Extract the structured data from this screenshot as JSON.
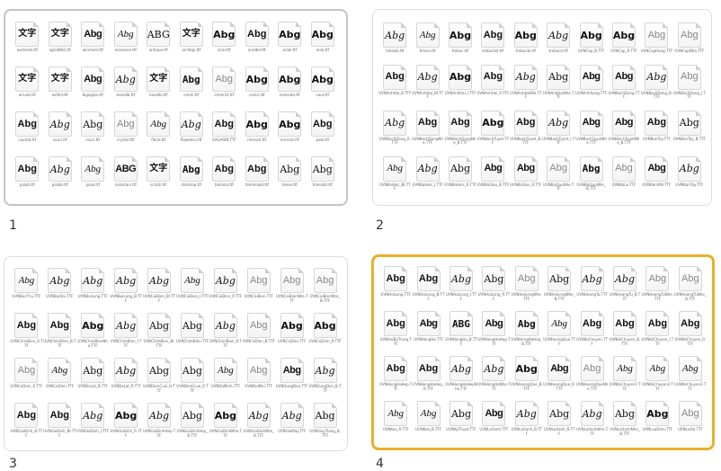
{
  "thumbnails": [
    {
      "caption": "1",
      "rows": [
        [
          {
            "glyph": "文字",
            "style": "cjk",
            "name": "aachenb.ttf"
          },
          {
            "glyph": "文字",
            "style": "cjk",
            "name": "agrotBlkt.ttf"
          },
          {
            "glyph": "Abg",
            "style": "black",
            "name": "aknimim.ttf"
          },
          {
            "glyph": "Abg",
            "style": "script",
            "name": "amazone.ttf"
          },
          {
            "glyph": "ABG",
            "style": "serif",
            "name": "antique.ttf"
          },
          {
            "glyph": "文字",
            "style": "cjk",
            "name": "archbpi.ttf"
          },
          {
            "glyph": "Abg",
            "style": "sans",
            "name": "arial.ttf"
          },
          {
            "glyph": "Abg",
            "style": "bold",
            "name": "arialbd.ttf"
          },
          {
            "glyph": "Abg",
            "style": "sans",
            "name": "ariali.ttf"
          },
          {
            "glyph": "Abg",
            "style": "sans",
            "name": "arial.ttf"
          }
        ],
        [
          {
            "glyph": "文字",
            "style": "cjk",
            "name": "arrude.ttf"
          },
          {
            "glyph": "文字",
            "style": "cjk",
            "name": "asfeld.ttf"
          },
          {
            "glyph": "Abg",
            "style": "black",
            "name": "bigapple.ttf"
          },
          {
            "glyph": "Abg",
            "style": "italic",
            "name": "bissallb.ttf"
          },
          {
            "glyph": "文字",
            "style": "cjk",
            "name": "bivaldo.ttf"
          },
          {
            "glyph": "Abg",
            "style": "mono",
            "name": "cmmi.ttf"
          },
          {
            "glyph": "Abg",
            "style": "light",
            "name": "cmmi10.ttf"
          },
          {
            "glyph": "Abg",
            "style": "sans",
            "name": "comic.ttf"
          },
          {
            "glyph": "Abg",
            "style": "sans",
            "name": "comicbd.ttf"
          },
          {
            "glyph": "Abg",
            "style": "sans",
            "name": "cour.ttf"
          }
        ],
        [
          {
            "glyph": "Abg",
            "style": "bold",
            "name": "courbd.ttf"
          },
          {
            "glyph": "Abg",
            "style": "italic",
            "name": "couri.ttf"
          },
          {
            "glyph": "Abg",
            "style": "serif",
            "name": "couri.ttf"
          },
          {
            "glyph": "Abg",
            "style": "light",
            "name": "crystal.ttf"
          },
          {
            "glyph": "Abg",
            "style": "script",
            "name": "floral.ttf"
          },
          {
            "glyph": "Abg",
            "style": "italic",
            "name": "flowdeco.ttf"
          },
          {
            "glyph": "Abg",
            "style": "bold",
            "name": "GAGARIN.TTF"
          },
          {
            "glyph": "Abg",
            "style": "sans",
            "name": "meroch.ttf"
          },
          {
            "glyph": "Abg",
            "style": "sans",
            "name": "micross.ttf"
          },
          {
            "glyph": "Abg",
            "style": "bold",
            "name": "pala.ttf"
          }
        ],
        [
          {
            "glyph": "Abg",
            "style": "bold",
            "name": "palab.ttf"
          },
          {
            "glyph": "Abg",
            "style": "italic",
            "name": "palabi.ttf"
          },
          {
            "glyph": "Abg",
            "style": "script",
            "name": "palai.ttf"
          },
          {
            "glyph": "ABG",
            "style": "black",
            "name": "rockstars.ttf"
          },
          {
            "glyph": "文字",
            "style": "cjk",
            "name": "scripti.ttf"
          },
          {
            "glyph": "Abg",
            "style": "mono",
            "name": "stardrop.ttf"
          },
          {
            "glyph": "Abg",
            "style": "bold",
            "name": "tahoma.ttf"
          },
          {
            "glyph": "Abg",
            "style": "bold",
            "name": "tahomabd.ttf"
          },
          {
            "glyph": "Abg",
            "style": "serif",
            "name": "times.ttf"
          },
          {
            "glyph": "Abg",
            "style": "serif",
            "name": "timesbd.ttf"
          }
        ]
      ]
    },
    {
      "caption": "2",
      "rows": [
        [
          {
            "glyph": "Abg",
            "style": "italic",
            "name": "timesbi.ttf"
          },
          {
            "glyph": "Abg",
            "style": "script",
            "name": "timesi.ttf"
          },
          {
            "glyph": "Abg",
            "style": "sans",
            "name": "trebuc.ttf"
          },
          {
            "glyph": "Abg",
            "style": "bold",
            "name": "trebucbd.ttf"
          },
          {
            "glyph": "Abg",
            "style": "sans",
            "name": "trebucbi.ttf"
          },
          {
            "glyph": "Abg",
            "style": "italic",
            "name": "trebucit.ttf"
          },
          {
            "glyph": "Abg",
            "style": "sans",
            "name": "UVNCap_B.TTF"
          },
          {
            "glyph": "Abg",
            "style": "sans",
            "name": "UVNCap_R.TTF"
          },
          {
            "glyph": "Abg",
            "style": "light",
            "name": "UVNCapHang.TTF"
          },
          {
            "glyph": "Abg",
            "style": "light",
            "name": "UVNCapNha.TTF"
          }
        ],
        [
          {
            "glyph": "Abg",
            "style": "bold",
            "name": "UVNAnhHai_B.TTF"
          },
          {
            "glyph": "Abg",
            "style": "italic",
            "name": "UVNAnhHai_BI.TTF"
          },
          {
            "glyph": "Abg",
            "style": "sans",
            "name": "UVNAnhHai_I.TTF"
          },
          {
            "glyph": "Abg",
            "style": "bold",
            "name": "UVNAnhHai_R.TTF"
          },
          {
            "glyph": "Abg",
            "style": "italic",
            "name": "UVNAnhHaiBlk.TTF"
          },
          {
            "glyph": "Abg",
            "style": "serif",
            "name": "UVNAnhHaiNhe.TTF"
          },
          {
            "glyph": "Abg",
            "style": "black",
            "name": "UVNAnhSang.TTF"
          },
          {
            "glyph": "Abg",
            "style": "black",
            "name": "UVNBachDang.TTF"
          },
          {
            "glyph": "Abg",
            "style": "italic",
            "name": "UVNBachDang_B.TTF"
          },
          {
            "glyph": "Abg",
            "style": "light",
            "name": "UVNBachDang_I.TTF"
          }
        ],
        [
          {
            "glyph": "Abg",
            "style": "italic",
            "name": "UVNBachDang_R.TTF"
          },
          {
            "glyph": "Abg",
            "style": "bold",
            "name": "UVNBachDangNhe.TTF"
          },
          {
            "glyph": "Abg",
            "style": "bold",
            "name": "UVNBachDangNhe_B.TTF"
          },
          {
            "glyph": "Abg",
            "style": "sans",
            "name": "UVNBachTuyet.TTF"
          },
          {
            "glyph": "Abg",
            "style": "bold",
            "name": "UVNBachTuyet_B.TTF"
          },
          {
            "glyph": "Abg",
            "style": "italic",
            "name": "UVNBachTuyet_I.TTF"
          },
          {
            "glyph": "Abg",
            "style": "black",
            "name": "UVNBachTuyetNhe.TTF"
          },
          {
            "glyph": "Abg",
            "style": "black",
            "name": "UVNBachTuyetNhe_B.TTF"
          },
          {
            "glyph": "Abg",
            "style": "bold",
            "name": "UVNBanTay.TTF"
          },
          {
            "glyph": "Abg",
            "style": "serif",
            "name": "UVNBanTay_B.TTF"
          }
        ],
        [
          {
            "glyph": "Abg",
            "style": "script",
            "name": "UVNBaiHoc_BI.TTF"
          },
          {
            "glyph": "Abg",
            "style": "italic",
            "name": "UVNBaiHoc_I.TTF"
          },
          {
            "glyph": "Abg",
            "style": "serif",
            "name": "UVNBaiHoc_R.TTF"
          },
          {
            "glyph": "Abg",
            "style": "black",
            "name": "UVNBaiSau_B.TTF"
          },
          {
            "glyph": "Abg",
            "style": "black",
            "name": "UVNBaiSau_R.TTF"
          },
          {
            "glyph": "Abg",
            "style": "light",
            "name": "UVNBaiSauNhe.TTF"
          },
          {
            "glyph": "Abg",
            "style": "mono",
            "name": "UVNBaiSauNhe_B.TTF"
          },
          {
            "glyph": "Abg",
            "style": "light",
            "name": "UVNBaLe.TTF"
          },
          {
            "glyph": "Abg",
            "style": "black",
            "name": "UVNBanhMi.TTF"
          },
          {
            "glyph": "Abg",
            "style": "italic",
            "name": "UVNBanTay.TTF"
          }
        ]
      ]
    },
    {
      "caption": "3",
      "rows": [
        [
          {
            "glyph": "Abg",
            "style": "script",
            "name": "UVNBucThu.TTF"
          },
          {
            "glyph": "Abg",
            "style": "italic",
            "name": "UVNBuiDoi.TTF"
          },
          {
            "glyph": "Abg",
            "style": "italic",
            "name": "UVNBuiLong.TTF"
          },
          {
            "glyph": "Abg",
            "style": "italic",
            "name": "UVNBuiLong_B.TTF"
          },
          {
            "glyph": "Abg",
            "style": "italic",
            "name": "UVNCaiBien_BI.TTF"
          },
          {
            "glyph": "Abg",
            "style": "script",
            "name": "UVNCaiBien_I.TTF"
          },
          {
            "glyph": "Abg",
            "style": "italic",
            "name": "UVNCaiBien_R.TTF"
          },
          {
            "glyph": "Abg",
            "style": "light",
            "name": "UVNCaiBien.TTF"
          },
          {
            "glyph": "Abg",
            "style": "light",
            "name": "UVNCaiBienNhe.TTF"
          },
          {
            "glyph": "Abg",
            "style": "light",
            "name": "UVNCaiBienNhe_B.TTF"
          }
        ],
        [
          {
            "glyph": "Abg",
            "style": "bold",
            "name": "UVNChimBien_R.TTF"
          },
          {
            "glyph": "Abg",
            "style": "bold",
            "name": "UVNChimBien_B.TTF"
          },
          {
            "glyph": "Abg",
            "style": "sans",
            "name": "UVNChimBienNhe.TTF"
          },
          {
            "glyph": "Abg",
            "style": "italic",
            "name": "UVNChimBien_I.TTF"
          },
          {
            "glyph": "Abg",
            "style": "serif",
            "name": "UVNChimBien_BI.TTF"
          },
          {
            "glyph": "Abg",
            "style": "serif",
            "name": "UVNChimBien.TTF"
          },
          {
            "glyph": "Abg",
            "style": "italic",
            "name": "UVNChimBien_R.TTF"
          },
          {
            "glyph": "Abg",
            "style": "light",
            "name": "UVNCoDien_B.TTF"
          },
          {
            "glyph": "Abg",
            "style": "sans",
            "name": "UVNCoDien.TTF"
          },
          {
            "glyph": "Abg",
            "style": "sans",
            "name": "UVNCoDien_R.TTF"
          }
        ],
        [
          {
            "glyph": "Abg",
            "style": "light",
            "name": "UVNCoDien_R.TTF"
          },
          {
            "glyph": "Abg",
            "style": "script",
            "name": "UVNCoDien.TTF"
          },
          {
            "glyph": "Abg",
            "style": "serif",
            "name": "UVNDaLat_B.TTF"
          },
          {
            "glyph": "Abg",
            "style": "italic",
            "name": "UVNDaLat_R.TTF"
          },
          {
            "glyph": "Abg",
            "style": "serif",
            "name": "UVNDamCuoi_H.TTF"
          },
          {
            "glyph": "Abg",
            "style": "serif",
            "name": "UVNDamCuoi_R.TTF"
          },
          {
            "glyph": "Abg",
            "style": "script",
            "name": "UVNDaMinh.TTF"
          },
          {
            "glyph": "Abg",
            "style": "light",
            "name": "UVNDoiMoi.TTF"
          },
          {
            "glyph": "Abg",
            "style": "black",
            "name": "UVNDungDan.TTF"
          },
          {
            "glyph": "Abg",
            "style": "italic",
            "name": "UVNDungDan_B.TTF"
          }
        ],
        [
          {
            "glyph": "Abg",
            "style": "bold",
            "name": "UVNGiaDinh_B.TTF"
          },
          {
            "glyph": "Abg",
            "style": "bold",
            "name": "UVNGiaDinh_BI.TTF"
          },
          {
            "glyph": "Abg",
            "style": "italic",
            "name": "UVNGiaDinh_I.TTF"
          },
          {
            "glyph": "Abg",
            "style": "sans",
            "name": "UVNGiaDinh_R.TTF"
          },
          {
            "glyph": "Abg",
            "style": "italic",
            "name": "UVNGiaDinhHep.TTF"
          },
          {
            "glyph": "Abg",
            "style": "serif",
            "name": "UVNGiaDinhHep_B.TTF"
          },
          {
            "glyph": "Abg",
            "style": "sans",
            "name": "UVNGiaDinhNhe.TTF"
          },
          {
            "glyph": "Abg",
            "style": "italic",
            "name": "UVNGiaDinhNhe_B.TTF"
          },
          {
            "glyph": "Abg",
            "style": "italic",
            "name": "UVNGioMay.TTF"
          },
          {
            "glyph": "Abg",
            "style": "serif",
            "name": "UVNGiayTrang_B.TTF"
          }
        ]
      ]
    },
    {
      "caption": "4",
      "rows": [
        [
          {
            "glyph": "Abg",
            "style": "bold",
            "name": "UVNHaiLong.TTF"
          },
          {
            "glyph": "Abg",
            "style": "bold",
            "name": "UVNHaiLong_B.TTF"
          },
          {
            "glyph": "Abg",
            "style": "italic",
            "name": "UVNHaiLong_I.TTF"
          },
          {
            "glyph": "Abg",
            "style": "serif",
            "name": "UVNHaiLong_R.TTF"
          },
          {
            "glyph": "Abg",
            "style": "light",
            "name": "UVNHaiLongNhe.TTF"
          },
          {
            "glyph": "Abg",
            "style": "serif",
            "name": "UVNHaiLongNhe_B.TTF"
          },
          {
            "glyph": "Abg",
            "style": "italic",
            "name": "UVNHoangTu.TTF"
          },
          {
            "glyph": "Abg",
            "style": "italic",
            "name": "UVNHoangTu_B.TTF"
          },
          {
            "glyph": "Abg",
            "style": "light",
            "name": "UVNHoangTuNhe.TTF"
          },
          {
            "glyph": "Abg",
            "style": "light",
            "name": "UVNHoangTuNhe_B.TTF"
          }
        ],
        [
          {
            "glyph": "Abg",
            "style": "bold",
            "name": "UVNHaiBaTrung.TTF"
          },
          {
            "glyph": "Abg",
            "style": "black",
            "name": "UVNHongHa.TTF"
          },
          {
            "glyph": "ABG",
            "style": "mono",
            "name": "UVNHongHa_B.TTF"
          },
          {
            "glyph": "Abg",
            "style": "black",
            "name": "UVNHongHaHep.TTF"
          },
          {
            "glyph": "Abg",
            "style": "mono",
            "name": "UVNHongHaHep_B.TTF"
          },
          {
            "glyph": "Abg",
            "style": "script",
            "name": "UVNHuongQue.TTF"
          },
          {
            "glyph": "Abg",
            "style": "bold",
            "name": "UVNKeChuyen.TTF"
          },
          {
            "glyph": "Abg",
            "style": "bold",
            "name": "UVNKeChuyen_B.TTF"
          },
          {
            "glyph": "Abg",
            "style": "bold",
            "name": "UVNKeChuyen_I.TTF"
          },
          {
            "glyph": "Abg",
            "style": "bold",
            "name": "UVNKeChuyen_R.TTF"
          }
        ],
        [
          {
            "glyph": "Abg",
            "style": "bold",
            "name": "UVNHongHaHep.TTF"
          },
          {
            "glyph": "Abg",
            "style": "bold",
            "name": "UVNHongHaHep_R.TTF"
          },
          {
            "glyph": "Abg",
            "style": "italic",
            "name": "UVNHongHaHepNhe.TTF"
          },
          {
            "glyph": "Abg",
            "style": "italic",
            "name": "UVNHongHaNhe.TTF"
          },
          {
            "glyph": "Abg",
            "style": "sans",
            "name": "UVNHuongQue_B.TTF"
          },
          {
            "glyph": "Abg",
            "style": "black",
            "name": "UVNHuongQue_R.TTF"
          },
          {
            "glyph": "Abg",
            "style": "light",
            "name": "UVNHuongQueNhe.TTF"
          },
          {
            "glyph": "Abg",
            "style": "script",
            "name": "UVNKeChuyen1.TTF"
          },
          {
            "glyph": "Abg",
            "style": "script",
            "name": "UVNKeChuyen2.TTF"
          },
          {
            "glyph": "Abg",
            "style": "script",
            "name": "UVNKeChuyen3.TTF"
          }
        ],
        [
          {
            "glyph": "Abg",
            "style": "script",
            "name": "UVNKeo_R.TTF"
          },
          {
            "glyph": "Abg",
            "style": "script",
            "name": "UVNKeo_B.TTF"
          },
          {
            "glyph": "Abg",
            "style": "serif",
            "name": "UVNKyThuat.TTF"
          },
          {
            "glyph": "Abg",
            "style": "black",
            "name": "UVNLaXanh.TTF"
          },
          {
            "glyph": "Abg",
            "style": "italic",
            "name": "UVNLaXanh_B.TTF"
          },
          {
            "glyph": "Abg",
            "style": "serif",
            "name": "UVNLaXanh_R.TTF"
          },
          {
            "glyph": "Abg",
            "style": "italic",
            "name": "UVNLaXanhNhe.TTF"
          },
          {
            "glyph": "Abg",
            "style": "serif",
            "name": "UVNLaXanhNhe_B.TTF"
          },
          {
            "glyph": "Abg",
            "style": "sans",
            "name": "UVNLuaDem.TTF"
          },
          {
            "glyph": "Abg",
            "style": "light",
            "name": "UVNLoiXa.TTF"
          }
        ]
      ]
    }
  ],
  "colors": {
    "selected_border": "#e8b02a"
  }
}
